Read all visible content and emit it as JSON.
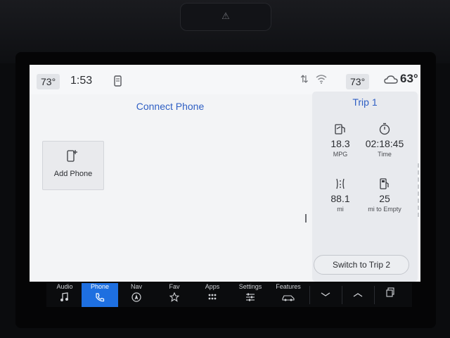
{
  "hardware": {
    "hazard_glyph": "⚠"
  },
  "status_bar": {
    "driver_temp": "73°",
    "clock": "1:53",
    "passenger_temp": "73°",
    "outside_temp": "63°"
  },
  "main": {
    "title": "Connect Phone",
    "add_phone_label": "Add Phone"
  },
  "trip": {
    "title": "Trip 1",
    "stats": [
      {
        "value": "18.3",
        "label": "MPG",
        "icon": "fuel-economy-icon"
      },
      {
        "value": "02:18:45",
        "label": "Time",
        "icon": "stopwatch-icon"
      },
      {
        "value": "88.1",
        "label": "mi",
        "icon": "distance-road-icon"
      },
      {
        "value": "25",
        "label": "mi to Empty",
        "icon": "fuel-pump-icon"
      }
    ],
    "switch_label": "Switch to Trip 2"
  },
  "nav": [
    {
      "label": "Audio",
      "icon": "music-note-icon"
    },
    {
      "label": "Phone",
      "icon": "phone-handset-icon",
      "active": true
    },
    {
      "label": "Nav",
      "icon": "nav-compass-icon"
    },
    {
      "label": "Fav",
      "icon": "favorite-star-icon"
    },
    {
      "label": "Apps",
      "icon": "apps-grid-icon"
    },
    {
      "label": "Settings",
      "icon": "settings-sliders-icon"
    },
    {
      "label": "Features",
      "icon": "vehicle-features-icon"
    },
    {
      "label": "",
      "icon": "chevron-down-icon"
    },
    {
      "label": "",
      "icon": "chevron-up-icon"
    },
    {
      "label": "",
      "icon": "screen-copy-icon"
    }
  ],
  "colors": {
    "accent": "#2f5fc4",
    "active_tab": "#1e6fe0",
    "screen_bg": "#f3f4f6"
  }
}
